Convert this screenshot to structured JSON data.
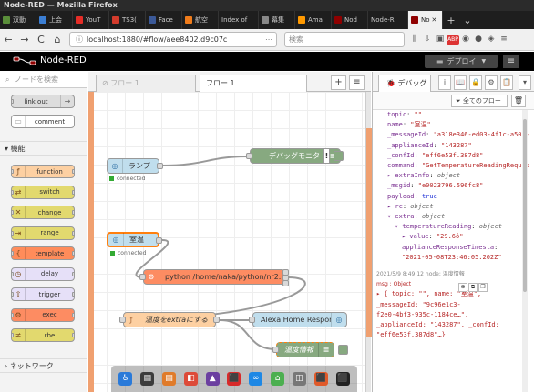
{
  "window": {
    "title": "Node-RED — Mozilla Firefox"
  },
  "browser_tabs": [
    {
      "label": "双動",
      "color": "#5a8e3a"
    },
    {
      "label": "上会",
      "color": "#3b7ed3"
    },
    {
      "label": "YouT",
      "color": "#e52d27"
    },
    {
      "label": "TS3(",
      "color": "#d33b2c"
    },
    {
      "label": "Face",
      "color": "#3b5998"
    },
    {
      "label": "航空",
      "color": "#f07c1b"
    },
    {
      "label": "Index of",
      "color": "#888888"
    },
    {
      "label": "幕集",
      "color": "#888888"
    },
    {
      "label": "Ama",
      "color": "#ff9900"
    },
    {
      "label": "Nod",
      "color": "#8f0000"
    },
    {
      "label": "Node-R",
      "color": "#8f0000"
    },
    {
      "label": "No",
      "color": "#8f0000",
      "active": true
    }
  ],
  "nav": {
    "url": "localhost:1880/#flow/aee8402.d9c07c",
    "search_placeholder": "検索",
    "back_icon": "←",
    "forward_icon": "→",
    "reload_icon": "C",
    "home_icon": "⌂"
  },
  "nodered": {
    "logo_text": "Node-RED",
    "deploy_label": "デプロイ",
    "menu_icon": "≡"
  },
  "palette": {
    "filter_placeholder": "ノードを検索",
    "top_nodes": [
      {
        "label": "link out",
        "color": "#dddddd",
        "icon": "→"
      },
      {
        "label": "comment",
        "color": "#ffffff",
        "icon": ""
      }
    ],
    "category_function": "機能",
    "function_nodes": [
      {
        "label": "function",
        "color": "#fdd0a2",
        "icon": "ƒ"
      },
      {
        "label": "switch",
        "color": "#e2d96e",
        "icon": "⇄"
      },
      {
        "label": "change",
        "color": "#e2d96e",
        "icon": "✕"
      },
      {
        "label": "range",
        "color": "#e2d96e",
        "icon": "⇥"
      },
      {
        "label": "template",
        "color": "#ff8c5a",
        "icon": "{"
      },
      {
        "label": "delay",
        "color": "#e6e0f8",
        "icon": "◷"
      },
      {
        "label": "trigger",
        "color": "#e6e0f8",
        "icon": "⇧"
      },
      {
        "label": "exec",
        "color": "#fd8c62",
        "icon": "⚙"
      },
      {
        "label": "rbe",
        "color": "#e2d96e",
        "icon": "≠"
      }
    ],
    "category_network": "ネットワーク"
  },
  "workspace": {
    "tab_inactive": "フロー 1",
    "tab_active": "フロー 1",
    "add_icon": "+",
    "list_icon": "≡",
    "nodes": {
      "lamp": {
        "label": "ランプ",
        "status": "connected"
      },
      "debug_monitor": {
        "label": "デバッグモニタ"
      },
      "temp_in": {
        "label": "室温",
        "status": "connected"
      },
      "python_exec": {
        "label": "python /home/naka/python/nr2.py"
      },
      "fn_extra": {
        "label": "温度をextraにする"
      },
      "alexa_resp": {
        "label": "Alexa Home Response"
      },
      "temp_debug": {
        "label": "温度情報"
      }
    }
  },
  "sidebar": {
    "tab_label": "デバッグ",
    "tab_icons": [
      "i",
      "📖",
      "🔒",
      "⚙",
      "📋"
    ],
    "filter_label": "全てのフロー",
    "trash_icon": "🗑",
    "debug_lines": [
      {
        "key": "topic",
        "val": "\"\"",
        "kind": "s"
      },
      {
        "key": "name",
        "val": "\"室温\"",
        "kind": "s"
      },
      {
        "key": "_messageId",
        "val": "\"a318e346-ed03-4f1c-a501-cc7d404234ee\"",
        "kind": "s"
      },
      {
        "key": "_applianceId",
        "val": "\"143287\"",
        "kind": "s"
      },
      {
        "key": "_confId",
        "val": "\"eff6e53f.387d8\"",
        "kind": "s"
      },
      {
        "key": "command",
        "val": "\"GetTemperatureReadingRequest\"",
        "kind": "s"
      },
      {
        "key": "▸ extraInfo",
        "val": "object",
        "kind": "o"
      },
      {
        "key": "_msgid",
        "val": "\"e0023796.596fc8\"",
        "kind": "s"
      },
      {
        "key": "payload",
        "val": "true",
        "kind": "n"
      },
      {
        "key": "▸ rc",
        "val": "object",
        "kind": "o"
      },
      {
        "key": "▾ extra",
        "val": "object",
        "kind": "o"
      },
      {
        "key": "▾ temperatureReading",
        "val": "object",
        "kind": "o"
      },
      {
        "key": "▸ value",
        "val": "\"29.6ô\"",
        "kind": "s"
      },
      {
        "key": "applianceResponseTimesta",
        "val": "",
        "kind": "s"
      },
      {
        "key": "",
        "val": "\"2021-05-08T23:46:05.202Z\"",
        "kind": "s"
      }
    ],
    "msg2_meta": "2021/5/9 8:49:12   node: 温度情報",
    "msg2_type": "msg : Object",
    "msg2_lines": [
      "▸ { topic: \"\", name: \"室温\",",
      "_messageId: \"9c96e1c3-",
      "f2e0-4bf3-935c-1184ce…\",",
      "_applianceId: \"143287\", _confId:",
      "\"eff6e53f.387d8\"…}"
    ]
  },
  "dock_icons": [
    "♿",
    "▤",
    "▤",
    "◧",
    "▲",
    "⬛",
    "∞",
    "⌂",
    "◫",
    "⬛",
    "⬛"
  ]
}
